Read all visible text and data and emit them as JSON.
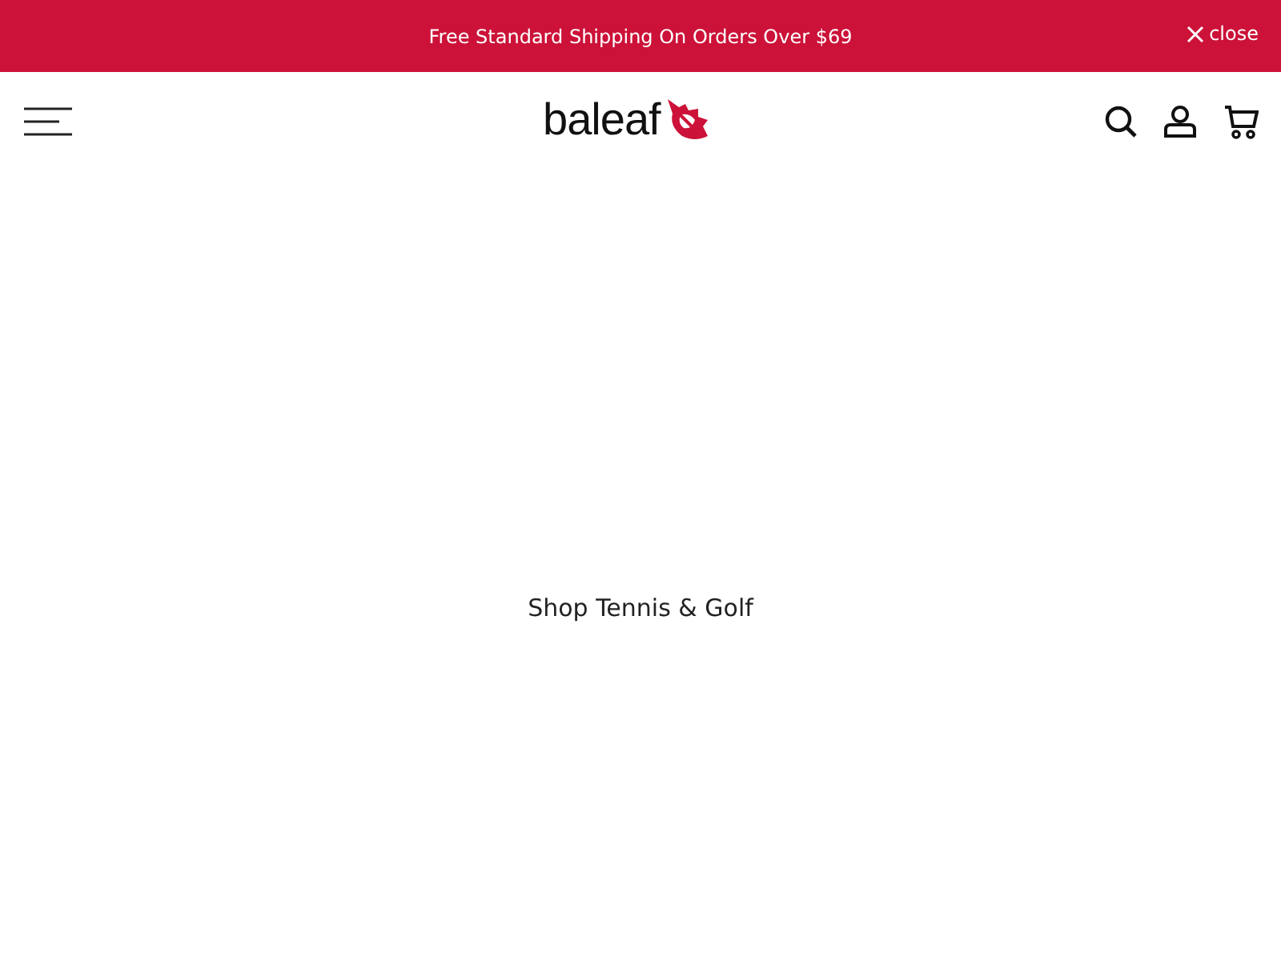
{
  "announcement": {
    "text": "Free Standard Shipping On Orders Over $69",
    "close_label": "close"
  },
  "header": {
    "logo_text": "baleaf"
  },
  "hero": {
    "link_text": "Shop Tennis & Golf"
  }
}
